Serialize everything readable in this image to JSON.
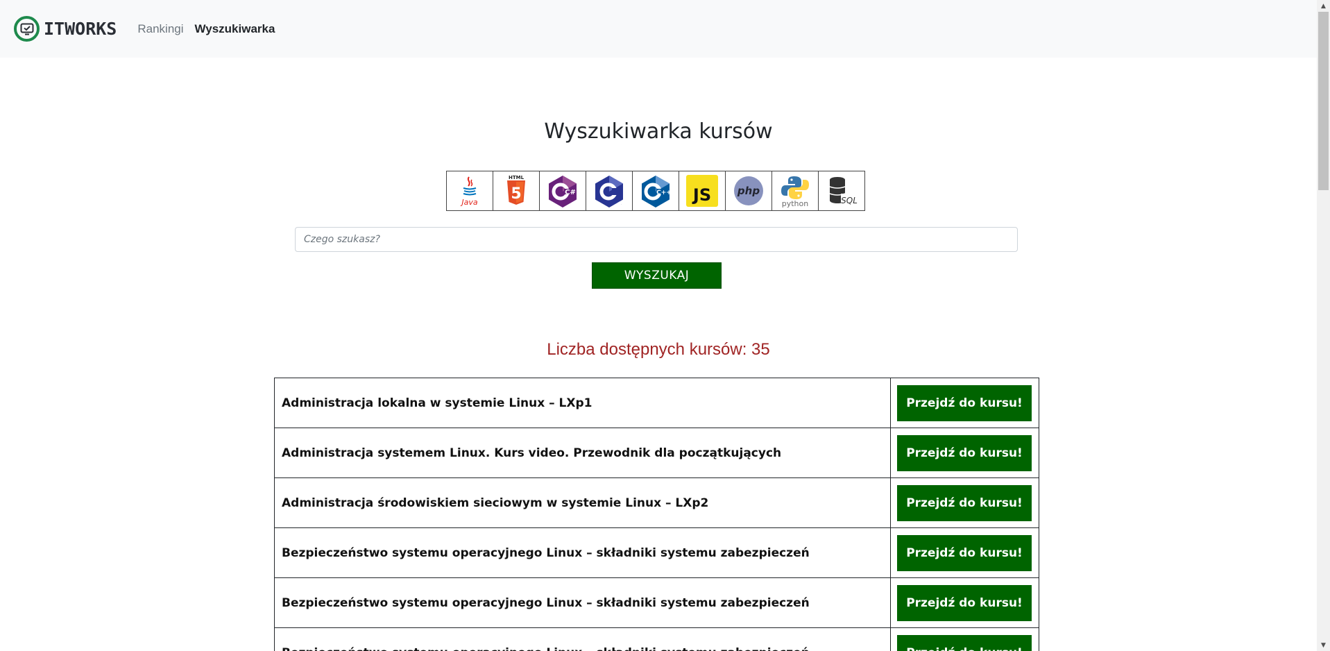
{
  "nav": {
    "brand": "ITWORKS",
    "links": [
      {
        "label": "Rankingi"
      },
      {
        "label": "Wyszukiwarka"
      }
    ]
  },
  "main": {
    "title": "Wyszukiwarka kursów",
    "languages": [
      {
        "icon": "java-icon",
        "label": "Java"
      },
      {
        "icon": "html5-icon",
        "label": "HTML"
      },
      {
        "icon": "csharp-icon",
        "label": "C#"
      },
      {
        "icon": "c-icon",
        "label": "C"
      },
      {
        "icon": "cplusplus-icon",
        "label": "C++"
      },
      {
        "icon": "javascript-icon",
        "label": "JS"
      },
      {
        "icon": "php-icon",
        "label": "php"
      },
      {
        "icon": "python-icon",
        "label": "python"
      },
      {
        "icon": "sql-icon",
        "label": "SQL"
      }
    ],
    "search_placeholder": "Czego szukasz?",
    "search_button": "WYSZUKAJ",
    "count_text": "Liczba dostępnych kursów: 35",
    "course_button": "Przejdź do kursu!",
    "courses": [
      {
        "title": "Administracja lokalna w systemie Linux – LXp1"
      },
      {
        "title": "Administracja systemem Linux. Kurs video. Przewodnik dla początkujących"
      },
      {
        "title": "Administracja środowiskiem sieciowym w systemie Linux – LXp2"
      },
      {
        "title": "Bezpieczeństwo systemu operacyjnego Linux – składniki systemu zabezpieczeń"
      },
      {
        "title": "Bezpieczeństwo systemu operacyjnego Linux – składniki systemu zabezpieczeń"
      },
      {
        "title": "Bezpieczeństwo systemu operacyjnego Linux – składniki systemu zabezpieczeń"
      }
    ]
  },
  "colors": {
    "accent_green": "#006400",
    "count_red": "#a02424",
    "navbar_bg": "#f8f9fa"
  }
}
